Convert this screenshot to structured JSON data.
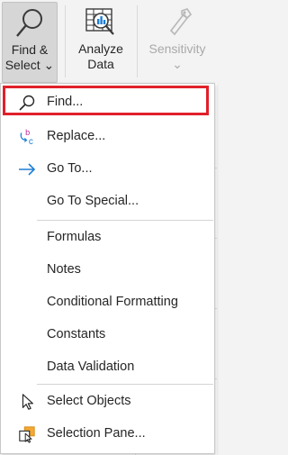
{
  "ribbon": {
    "find_select": {
      "label_line1": "Find &",
      "label_line2": "Select",
      "chevron": "⌄",
      "icon": "magnifier-icon"
    },
    "analyze_data": {
      "label_line1": "Analyze",
      "label_line2": "Data",
      "icon": "analyze-data-icon"
    },
    "sensitivity": {
      "label": "Sensitivity",
      "chevron": "⌄",
      "icon": "sensitivity-icon"
    }
  },
  "menu": {
    "items": [
      {
        "label": "Find...",
        "icon": "search-icon"
      },
      {
        "label": "Replace...",
        "icon": "replace-icon"
      },
      {
        "label": "Go To...",
        "icon": "arrow-right-icon"
      },
      {
        "label": "Go To Special...",
        "icon": ""
      },
      {
        "label": "Formulas",
        "icon": ""
      },
      {
        "label": "Notes",
        "icon": ""
      },
      {
        "label": "Conditional Formatting",
        "icon": ""
      },
      {
        "label": "Constants",
        "icon": ""
      },
      {
        "label": "Data Validation",
        "icon": ""
      },
      {
        "label": "Select Objects",
        "icon": "cursor-arrow-icon"
      },
      {
        "label": "Selection Pane...",
        "icon": "selection-pane-icon"
      }
    ]
  },
  "colors": {
    "highlight": "#e0202a",
    "accent": "#1e7fd6"
  }
}
